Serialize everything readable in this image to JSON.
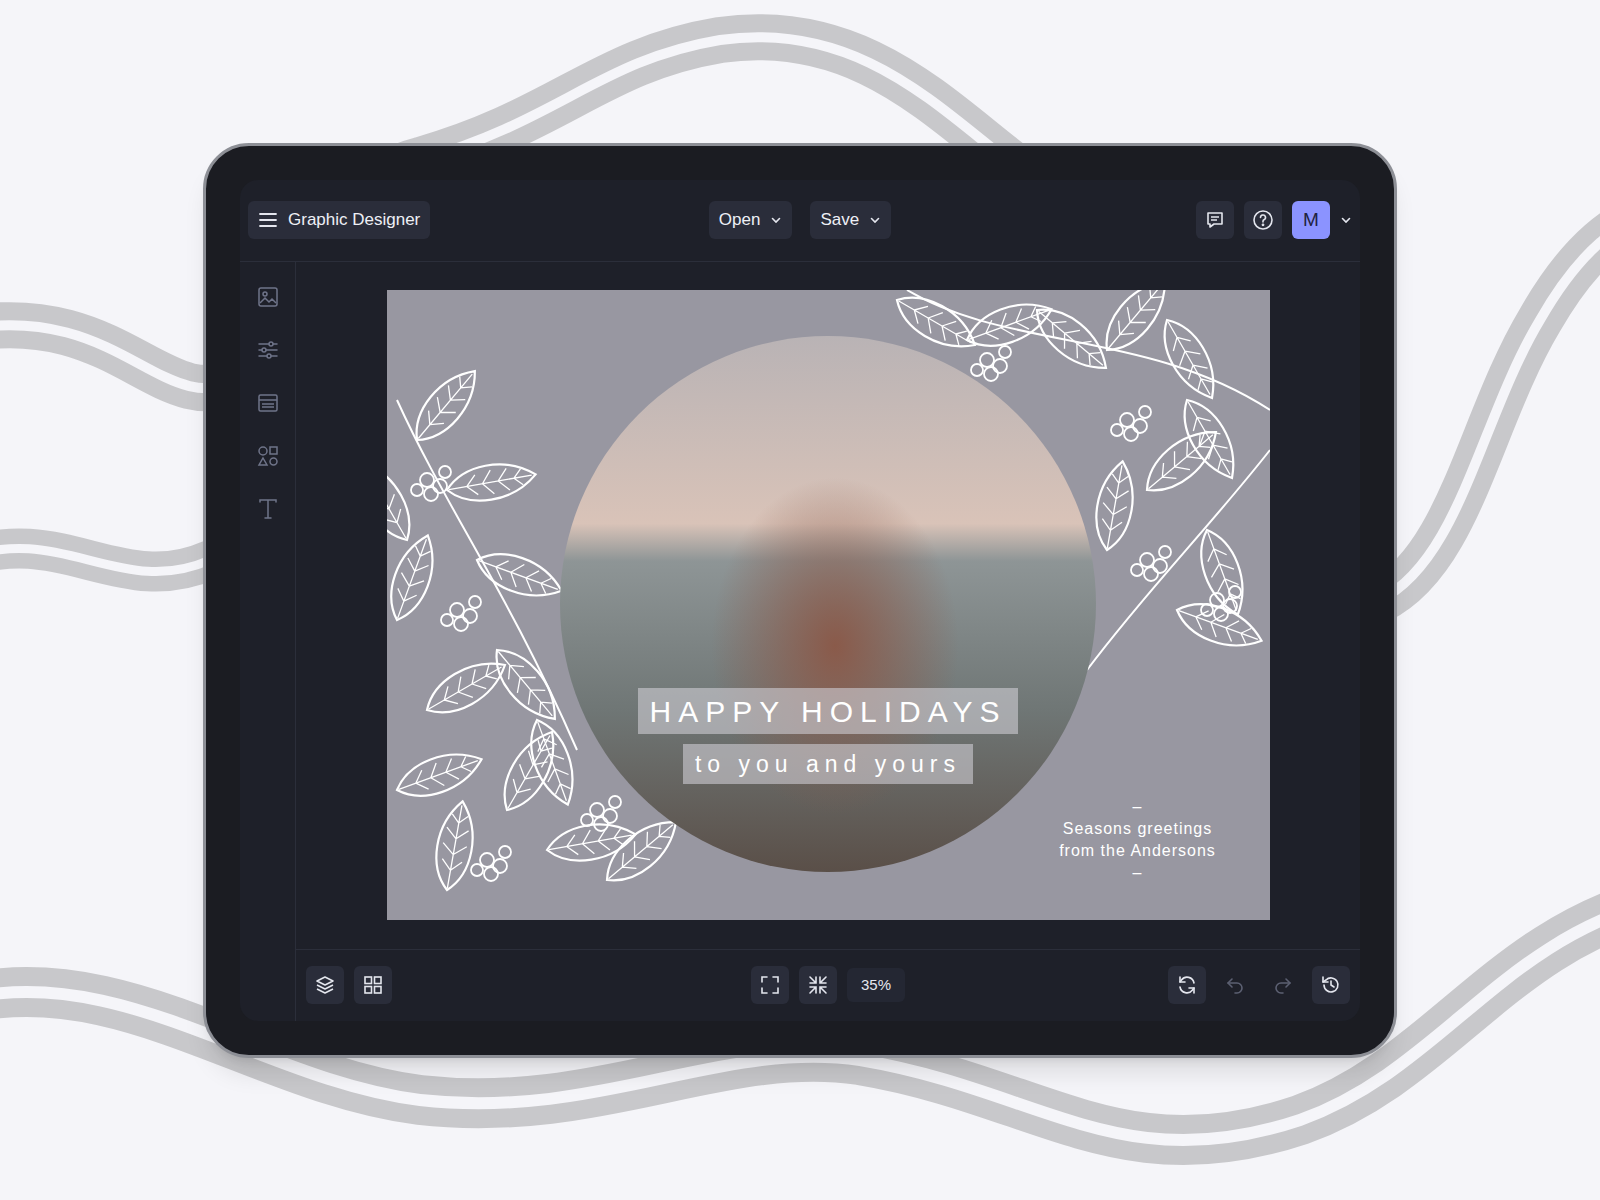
{
  "app": {
    "title": "Graphic Designer"
  },
  "menus": [
    {
      "label": "Open"
    },
    {
      "label": "Save"
    }
  ],
  "user": {
    "initial": "M"
  },
  "card": {
    "headline": "HAPPY HOLIDAYS",
    "subline": "to you and yours",
    "dash_top": "–",
    "greeting": [
      "Seasons greetings",
      "from the Andersons"
    ],
    "dash_bottom": "–"
  },
  "zoom": {
    "reading": "35%"
  },
  "history_buttons": [
    {
      "kind": "undo",
      "disabled": true
    },
    {
      "kind": "redo",
      "disabled": true
    }
  ]
}
